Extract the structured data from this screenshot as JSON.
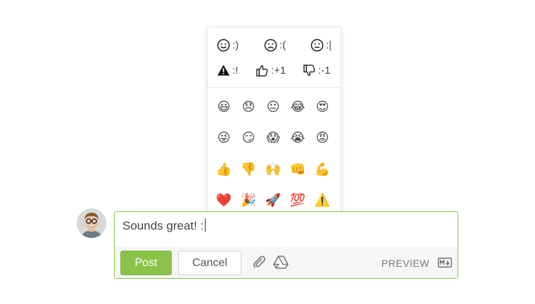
{
  "emoji_popup": {
    "shortcuts": [
      {
        "icon": "smile-face-icon",
        "label": ":)"
      },
      {
        "icon": "frown-face-icon",
        "label": ":("
      },
      {
        "icon": "neutral-face-icon",
        "label": ":|"
      },
      {
        "icon": "warning-icon",
        "label": ":!"
      },
      {
        "icon": "thumbs-up-icon",
        "label": ":+1"
      },
      {
        "icon": "thumbs-down-icon",
        "label": ":-1"
      }
    ],
    "emojis": [
      "😃",
      "😞",
      "😐",
      "😂",
      "😍",
      "😜",
      "😏",
      "😱",
      "😭",
      "😡",
      "👍",
      "👎",
      "🙌",
      "👊",
      "💪",
      "❤️",
      "🎉",
      "🚀",
      "💯",
      "⚠️"
    ]
  },
  "comment": {
    "text": "Sounds great! :",
    "post_label": "Post",
    "cancel_label": "Cancel",
    "preview_label": "PREVIEW"
  },
  "colors": {
    "accent": "#8bc34a",
    "editor_border": "#8ac53e"
  }
}
